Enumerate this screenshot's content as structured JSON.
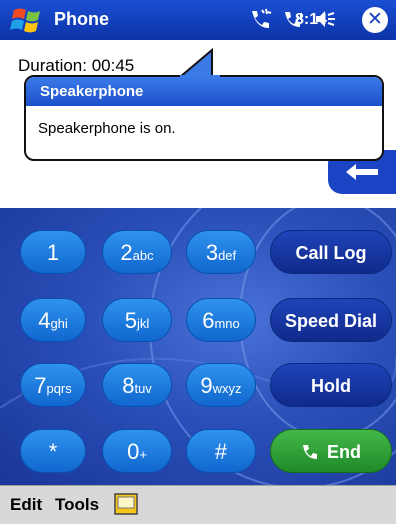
{
  "titlebar": {
    "app_title": "Phone",
    "time": "8:14",
    "icons": [
      "start-flag-icon",
      "phone-activity-icon",
      "signal-icon",
      "volume-icon",
      "close-icon"
    ],
    "close_glyph": "✕"
  },
  "call": {
    "duration": "Duration: 00:45"
  },
  "notification": {
    "title": "Speakerphone",
    "message": "Speakerphone is on."
  },
  "keypad": {
    "keys": [
      {
        "digit": "1",
        "letters": ""
      },
      {
        "digit": "2",
        "letters": "abc"
      },
      {
        "digit": "3",
        "letters": "def"
      },
      {
        "digit": "4",
        "letters": "ghi"
      },
      {
        "digit": "5",
        "letters": "jkl"
      },
      {
        "digit": "6",
        "letters": "mno"
      },
      {
        "digit": "7",
        "letters": "pqrs"
      },
      {
        "digit": "8",
        "letters": "tuv"
      },
      {
        "digit": "9",
        "letters": "wxyz"
      },
      {
        "digit": "*",
        "letters": ""
      },
      {
        "digit": "0",
        "letters": "+"
      },
      {
        "digit": "#",
        "letters": ""
      }
    ],
    "actions": {
      "call_log": "Call Log",
      "speed_dial": "Speed Dial",
      "hold": "Hold",
      "end": "End"
    },
    "colors": {
      "key": "#1f7fe0",
      "action": "#1a3aa8",
      "end": "#2e9e36"
    }
  },
  "menubar": {
    "edit": "Edit",
    "tools": "Tools",
    "input_icon": "keyboard-icon"
  }
}
